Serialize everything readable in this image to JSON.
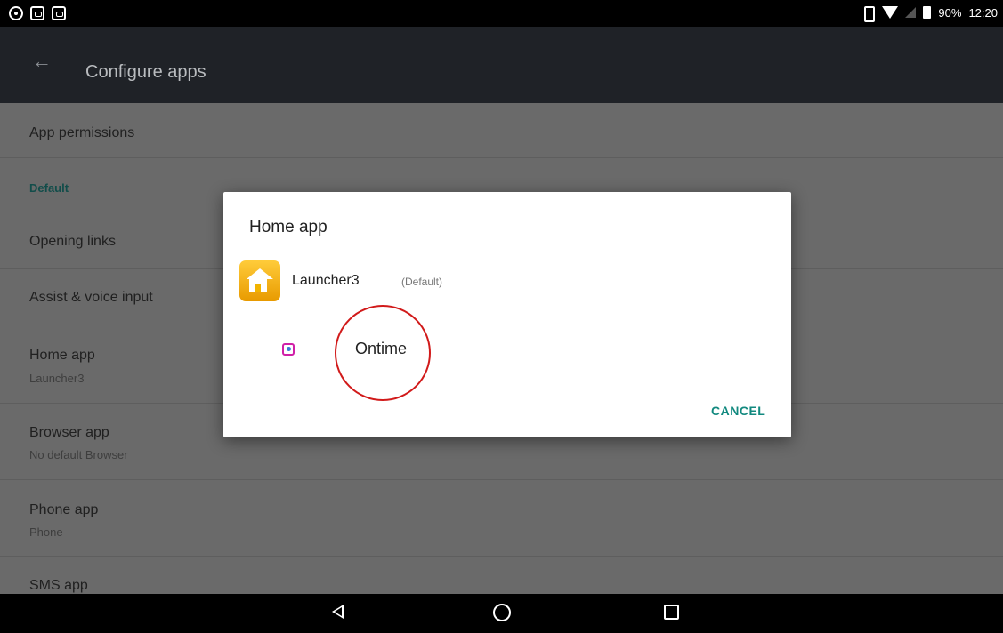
{
  "status_bar": {
    "battery": "90%",
    "time": "12:20"
  },
  "toolbar": {
    "title": "Configure apps",
    "back_icon": "arrow-back-icon"
  },
  "settings": {
    "app_permissions": "App permissions",
    "default_header": "Default",
    "opening_links": "Opening links",
    "assist_voice": "Assist & voice input",
    "home_app": {
      "title": "Home app",
      "summary": "Launcher3"
    },
    "browser_app": {
      "title": "Browser app",
      "summary": "No default Browser"
    },
    "phone_app": {
      "title": "Phone app",
      "summary": "Phone"
    },
    "sms_app": "SMS app"
  },
  "dialog": {
    "title": "Home app",
    "options": [
      {
        "label": "Launcher3",
        "tag": "(Default)",
        "icon": "home-launcher-icon"
      },
      {
        "label": "Ontime",
        "icon": "ontime-app-icon"
      }
    ],
    "cancel_label": "CANCEL"
  },
  "colors": {
    "accent": "#12897f",
    "annotation": "#d11a1a"
  }
}
